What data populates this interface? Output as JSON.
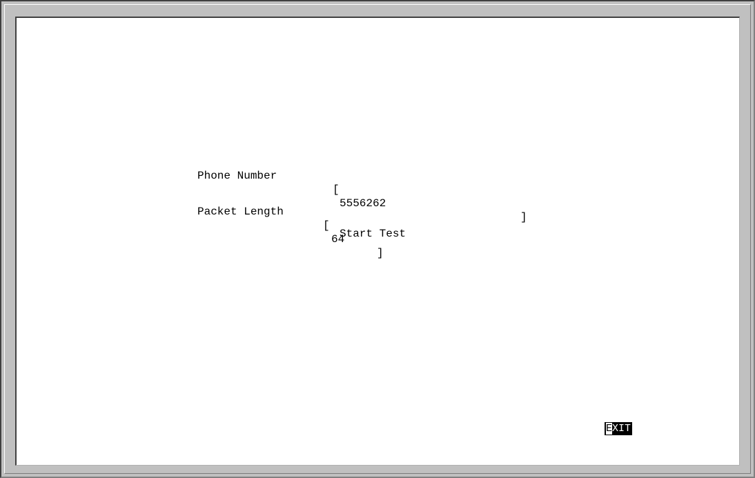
{
  "form": {
    "phone_number": {
      "label": "Phone Number",
      "open_bracket": "[",
      "value": "5556262",
      "close_bracket": "]"
    },
    "packet_length": {
      "label": "Packet Length",
      "open_bracket": "[",
      "value": "64",
      "close_bracket": "]"
    },
    "start_test_label": "Start Test"
  },
  "footer": {
    "exit_first_char": "E",
    "exit_rest": "XIT"
  }
}
